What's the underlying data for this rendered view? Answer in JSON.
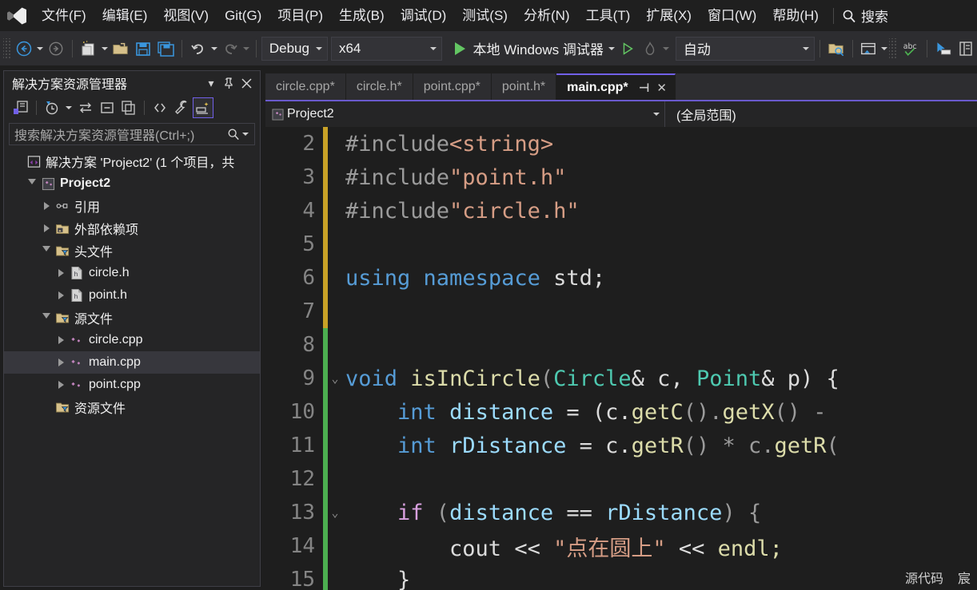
{
  "app": {
    "logo_icon": "visual-studio-logo",
    "menu": [
      {
        "label": "文件(F)",
        "name": "file"
      },
      {
        "label": "编辑(E)",
        "name": "edit"
      },
      {
        "label": "视图(V)",
        "name": "view"
      },
      {
        "label": "Git(G)",
        "name": "git"
      },
      {
        "label": "项目(P)",
        "name": "project"
      },
      {
        "label": "生成(B)",
        "name": "build"
      },
      {
        "label": "调试(D)",
        "name": "debug"
      },
      {
        "label": "测试(S)",
        "name": "test"
      },
      {
        "label": "分析(N)",
        "name": "analyze"
      },
      {
        "label": "工具(T)",
        "name": "tools"
      },
      {
        "label": "扩展(X)",
        "name": "extensions"
      },
      {
        "label": "窗口(W)",
        "name": "window"
      },
      {
        "label": "帮助(H)",
        "name": "help"
      }
    ],
    "search": {
      "icon": "search-icon",
      "label": "搜索"
    }
  },
  "toolbar": {
    "back_icon": "navigate-back-icon",
    "forward_icon": "navigate-forward-icon",
    "new_item_icon": "new-item-icon",
    "open_icon": "open-file-icon",
    "save_icon": "save-icon",
    "save_all_icon": "save-all-icon",
    "undo_icon": "undo-icon",
    "redo_icon": "redo-icon",
    "config": {
      "value": "Debug",
      "name": "solution-configuration"
    },
    "platform": {
      "value": "x64",
      "name": "solution-platform"
    },
    "run": {
      "label": "本地 Windows 调试器",
      "icon": "run-play-icon"
    },
    "attach_icon": "attach-process-icon",
    "hot_reload_icon": "hot-reload-icon",
    "auto": {
      "value": "自动",
      "name": "process-selector"
    },
    "find_in_files_icon": "find-in-files-icon",
    "window_layout_icon": "window-layout-icon",
    "spell_check_icon": "spell-check-icon",
    "select_tool_icon": "select-tool-icon",
    "panel_icon": "panel-icon"
  },
  "solution_explorer": {
    "title": "解决方案资源管理器",
    "header_icons": [
      "chevron-down-icon",
      "pin-icon",
      "close-icon"
    ],
    "toolbar_icons": [
      "home-solution-icon",
      "pending-changes-icon",
      "sync-with-active-document-icon",
      "collapse-all-icon",
      "properties-window-icon",
      "show-all-files-icon",
      "properties-wrench-icon",
      "preview-selected-items-icon"
    ],
    "search_placeholder": "搜索解决方案资源管理器(Ctrl+;)",
    "search_value": "",
    "search_icon": "search-icon",
    "tree": [
      {
        "label": "解决方案 'Project2' (1 个项目，共",
        "depth": 0,
        "arrow": "none",
        "icon": "solution-icon",
        "bold": false,
        "selected": false
      },
      {
        "label": "Project2",
        "depth": 1,
        "arrow": "open",
        "icon": "project-cpp-icon",
        "bold": true,
        "selected": false
      },
      {
        "label": "引用",
        "depth": 2,
        "arrow": "closed",
        "icon": "references-icon",
        "bold": false,
        "selected": false
      },
      {
        "label": "外部依赖项",
        "depth": 2,
        "arrow": "closed",
        "icon": "external-deps-icon",
        "bold": false,
        "selected": false
      },
      {
        "label": "头文件",
        "depth": 2,
        "arrow": "open",
        "icon": "filter-folder-icon",
        "bold": false,
        "selected": false
      },
      {
        "label": "circle.h",
        "depth": 3,
        "arrow": "closed",
        "icon": "header-file-icon",
        "bold": false,
        "selected": false
      },
      {
        "label": "point.h",
        "depth": 3,
        "arrow": "closed",
        "icon": "header-file-icon",
        "bold": false,
        "selected": false
      },
      {
        "label": "源文件",
        "depth": 2,
        "arrow": "open",
        "icon": "filter-folder-icon",
        "bold": false,
        "selected": false
      },
      {
        "label": "circle.cpp",
        "depth": 3,
        "arrow": "closed",
        "icon": "cpp-file-icon",
        "bold": false,
        "selected": false
      },
      {
        "label": "main.cpp",
        "depth": 3,
        "arrow": "closed",
        "icon": "cpp-file-icon",
        "bold": false,
        "selected": true
      },
      {
        "label": "point.cpp",
        "depth": 3,
        "arrow": "closed",
        "icon": "cpp-file-icon",
        "bold": false,
        "selected": false
      },
      {
        "label": "资源文件",
        "depth": 2,
        "arrow": "none",
        "icon": "filter-folder-icon",
        "bold": false,
        "selected": false
      }
    ]
  },
  "editor": {
    "tabs": [
      {
        "label": "circle.cpp*",
        "active": false
      },
      {
        "label": "circle.h*",
        "active": false
      },
      {
        "label": "point.cpp*",
        "active": false
      },
      {
        "label": "point.h*",
        "active": false
      },
      {
        "label": "main.cpp*",
        "active": true
      }
    ],
    "tab_actions": {
      "pin_icon": "pin-tab-icon",
      "close_icon": "close-tab-icon"
    },
    "nav_project": "Project2",
    "nav_project_icon": "project-cpp-icon",
    "nav_scope": "(全局范围)",
    "lines": [
      {
        "num": "2",
        "change": "y",
        "fold": "",
        "tokens": [
          {
            "t": "#include",
            "c": "pp"
          },
          {
            "t": "<string>",
            "c": "str"
          }
        ]
      },
      {
        "num": "3",
        "change": "y",
        "fold": "",
        "tokens": [
          {
            "t": "#include",
            "c": "pp"
          },
          {
            "t": "\"point.h\"",
            "c": "str"
          }
        ]
      },
      {
        "num": "4",
        "change": "y",
        "fold": "",
        "tokens": [
          {
            "t": "#include",
            "c": "pp"
          },
          {
            "t": "\"circle.h\"",
            "c": "str"
          }
        ]
      },
      {
        "num": "5",
        "change": "y",
        "fold": "",
        "tokens": []
      },
      {
        "num": "6",
        "change": "y",
        "fold": "",
        "tokens": [
          {
            "t": "using",
            "c": "kw"
          },
          {
            "t": " ",
            "c": "pln"
          },
          {
            "t": "namespace",
            "c": "kw"
          },
          {
            "t": " std;",
            "c": "pln"
          }
        ]
      },
      {
        "num": "7",
        "change": "y",
        "fold": "",
        "tokens": []
      },
      {
        "num": "8",
        "change": "g",
        "fold": "",
        "tokens": []
      },
      {
        "num": "9",
        "change": "g",
        "fold": "collapse",
        "tokens": [
          {
            "t": "void",
            "c": "kw"
          },
          {
            "t": " ",
            "c": "pln"
          },
          {
            "t": "isInCircle",
            "c": "fn"
          },
          {
            "t": "(",
            "c": "pnc"
          },
          {
            "t": "Circle",
            "c": "typ"
          },
          {
            "t": "& c, ",
            "c": "pln"
          },
          {
            "t": "Point",
            "c": "typ"
          },
          {
            "t": "& p) {",
            "c": "pln"
          }
        ]
      },
      {
        "num": "10",
        "change": "g",
        "fold": "",
        "tokens": [
          {
            "t": "    ",
            "c": "pln"
          },
          {
            "t": "int",
            "c": "kw"
          },
          {
            "t": " ",
            "c": "pln"
          },
          {
            "t": "distance",
            "c": "var"
          },
          {
            "t": " = (c.",
            "c": "pln"
          },
          {
            "t": "getC",
            "c": "fn"
          },
          {
            "t": "().",
            "c": "pnc"
          },
          {
            "t": "getX",
            "c": "fn"
          },
          {
            "t": "() -",
            "c": "pnc"
          }
        ]
      },
      {
        "num": "11",
        "change": "g",
        "fold": "",
        "tokens": [
          {
            "t": "    ",
            "c": "pln"
          },
          {
            "t": "int",
            "c": "kw"
          },
          {
            "t": " ",
            "c": "pln"
          },
          {
            "t": "rDistance",
            "c": "var"
          },
          {
            "t": " = c.",
            "c": "pln"
          },
          {
            "t": "getR",
            "c": "fn"
          },
          {
            "t": "() * c.",
            "c": "pnc"
          },
          {
            "t": "getR",
            "c": "fn"
          },
          {
            "t": "(",
            "c": "pnc"
          }
        ]
      },
      {
        "num": "12",
        "change": "g",
        "fold": "",
        "tokens": []
      },
      {
        "num": "13",
        "change": "g",
        "fold": "collapse",
        "tokens": [
          {
            "t": "    ",
            "c": "pln"
          },
          {
            "t": "if",
            "c": "ctl"
          },
          {
            "t": " (",
            "c": "pnc"
          },
          {
            "t": "distance",
            "c": "var"
          },
          {
            "t": " == ",
            "c": "pln"
          },
          {
            "t": "rDistance",
            "c": "var"
          },
          {
            "t": ") {",
            "c": "pnc"
          }
        ]
      },
      {
        "num": "14",
        "change": "g",
        "fold": "",
        "tokens": [
          {
            "t": "        cout << ",
            "c": "pln"
          },
          {
            "t": "\"点在圆上\"",
            "c": "str"
          },
          {
            "t": " << ",
            "c": "pln"
          },
          {
            "t": "endl;",
            "c": "fn"
          }
        ]
      },
      {
        "num": "15",
        "change": "g",
        "fold": "",
        "tokens": [
          {
            "t": "    }",
            "c": "pln"
          }
        ]
      }
    ],
    "status_right": [
      "源代码",
      "宸"
    ]
  },
  "colors": {
    "accent_purple": "#7160e8",
    "change_unsaved": "#c9a227",
    "change_saved": "#4caf50",
    "editor_bg": "#1e1e1e",
    "chrome_bg": "#2d2d30",
    "panel_bg": "#252526"
  }
}
